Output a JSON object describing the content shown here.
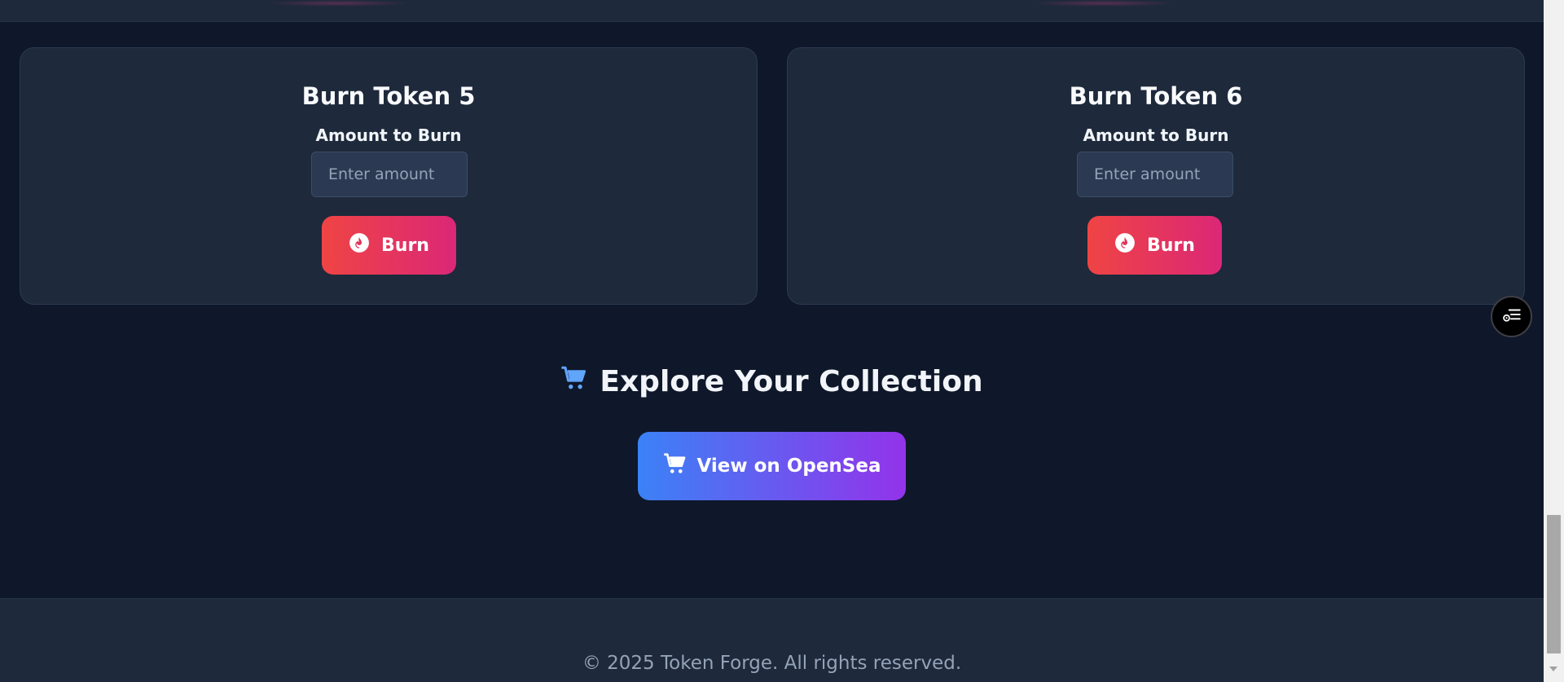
{
  "cards": [
    {
      "title": "Burn Token 5",
      "amount_label": "Amount to Burn",
      "input_placeholder": "Enter amount",
      "input_value": "",
      "button_label": "Burn",
      "button_icon": "fire-icon"
    },
    {
      "title": "Burn Token 6",
      "amount_label": "Amount to Burn",
      "input_placeholder": "Enter amount",
      "input_value": "",
      "button_label": "Burn",
      "button_icon": "fire-icon"
    }
  ],
  "explore": {
    "heading": "Explore Your Collection",
    "heading_icon": "shopping-cart-icon",
    "button_label": "View on OpenSea",
    "button_icon": "shopping-cart-icon"
  },
  "footer": {
    "copyright": "© 2025 Token Forge. All rights reserved."
  },
  "floating_button": {
    "icon": "list-settings-icon"
  },
  "colors": {
    "background": "#0f172a",
    "card": "#1e293b",
    "burn_gradient": [
      "#ef4444",
      "#db2777"
    ],
    "opensea_gradient": [
      "#3b82f6",
      "#9333ea"
    ],
    "cart_accent": "#60a5fa"
  }
}
